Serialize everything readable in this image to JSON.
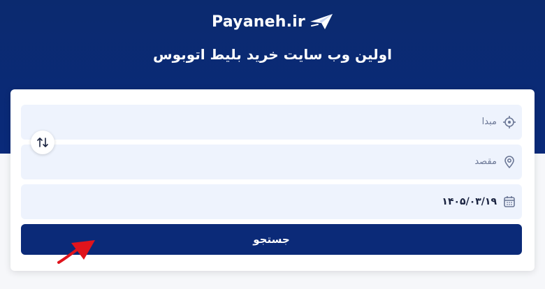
{
  "header": {
    "brand": "Payaneh.ir",
    "tagline": "اولین وب سایت خرید بلیط اتوبوس"
  },
  "form": {
    "origin_label": "مبدا",
    "destination_label": "مقصد",
    "date_value": "۱۴۰۵/۰۳/۱۹",
    "search_label": "جستجو"
  },
  "icons": {
    "logo": "paper-plane-logo-icon",
    "origin": "crosshair-icon",
    "destination": "location-pin-icon",
    "date": "calendar-icon",
    "swap": "swap-arrows-icon",
    "pointer": "red-arrow-icon"
  },
  "colors": {
    "header_bg": "#0b2a6f",
    "field_bg": "#eef3fd",
    "button_bg": "#0b2a78",
    "pointer": "#e0141c"
  }
}
